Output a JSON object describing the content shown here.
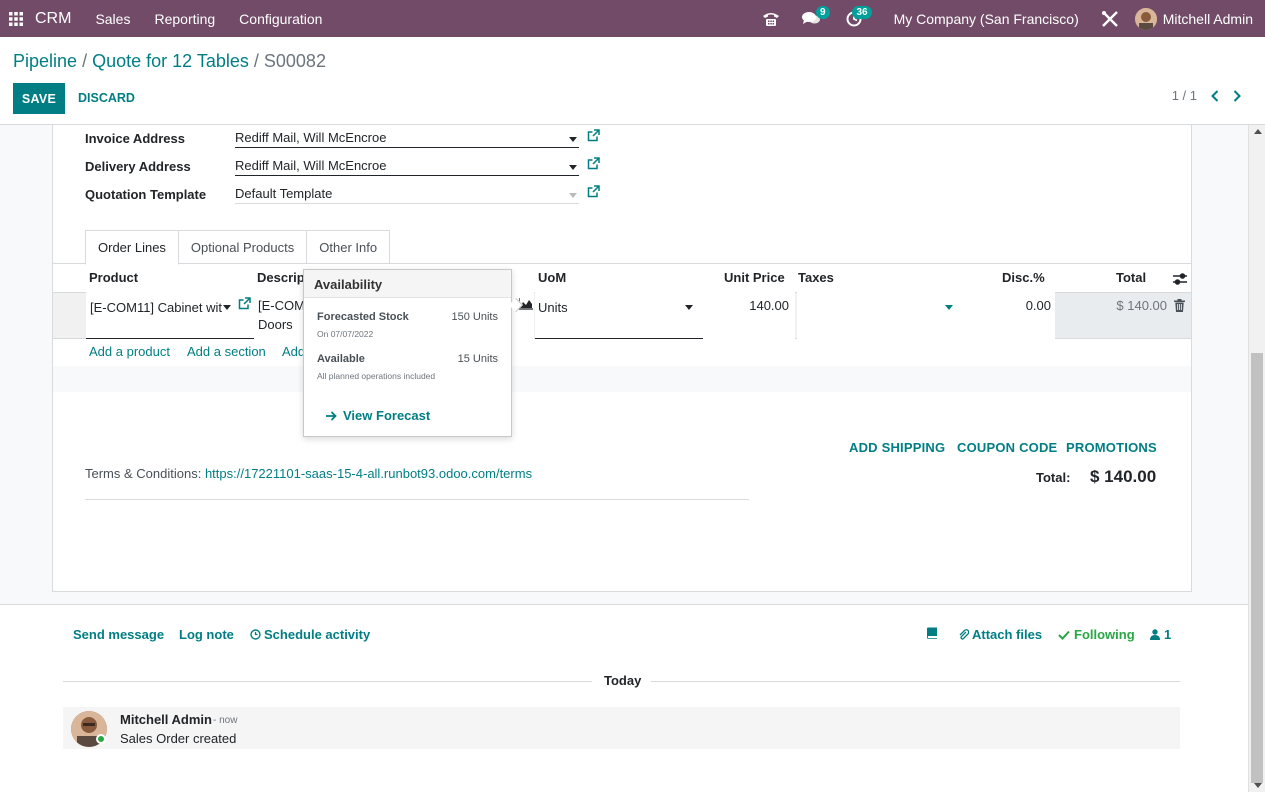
{
  "navbar": {
    "brand": "CRM",
    "menus": [
      "Sales",
      "Reporting",
      "Configuration"
    ],
    "messages_badge": "9",
    "activities_badge": "36",
    "company": "My Company (San Francisco)",
    "user": "Mitchell Admin",
    "bg_color": "#714b67"
  },
  "control": {
    "breadcrumb": [
      "Pipeline",
      "Quote for 12 Tables",
      "S00082"
    ],
    "save_label": "SAVE",
    "discard_label": "DISCARD",
    "pager": "1 / 1"
  },
  "form": {
    "fields": [
      {
        "label": "Invoice Address",
        "value": "Rediff Mail, Will McEncroe"
      },
      {
        "label": "Delivery Address",
        "value": "Rediff Mail, Will McEncroe"
      },
      {
        "label": "Quotation Template",
        "value": "Default Template"
      }
    ],
    "tabs": [
      "Order Lines",
      "Optional Products",
      "Other Info"
    ],
    "columns": {
      "product": "Product",
      "description": "Descript",
      "uom": "UoM",
      "unit_price": "Unit Price",
      "taxes": "Taxes",
      "disc": "Disc.%",
      "total": "Total"
    },
    "line": {
      "product": "[E-COM11] Cabinet wit",
      "description_1": "[E-COM1",
      "description_2": "Doors",
      "uom": "Units",
      "unit_price": "140.00",
      "disc": "0.00",
      "total": "$ 140.00"
    },
    "add_links": [
      "Add a product",
      "Add a section",
      "Add"
    ],
    "actions": [
      "ADD SHIPPING",
      "COUPON CODE",
      "PROMOTIONS"
    ],
    "terms_label": "Terms & Conditions:",
    "terms_url": "https://17221101-saas-15-4-all.runbot93.odoo.com/terms",
    "total_label": "Total:",
    "total_value": "$ 140.00"
  },
  "popover": {
    "title": "Availability",
    "forecast_label": "Forecasted Stock",
    "forecast_value": "150 Units",
    "forecast_date": "On 07/07/2022",
    "available_label": "Available",
    "available_value": "15 Units",
    "available_note": "All planned operations included",
    "link": "View Forecast"
  },
  "chatter": {
    "send_message": "Send message",
    "log_note": "Log note",
    "schedule_activity": "Schedule activity",
    "attach_files": "Attach files",
    "following": "Following",
    "followers_count": "1",
    "today": "Today",
    "message": {
      "author": "Mitchell Admin",
      "time": "- now",
      "body": "Sales Order created"
    }
  }
}
